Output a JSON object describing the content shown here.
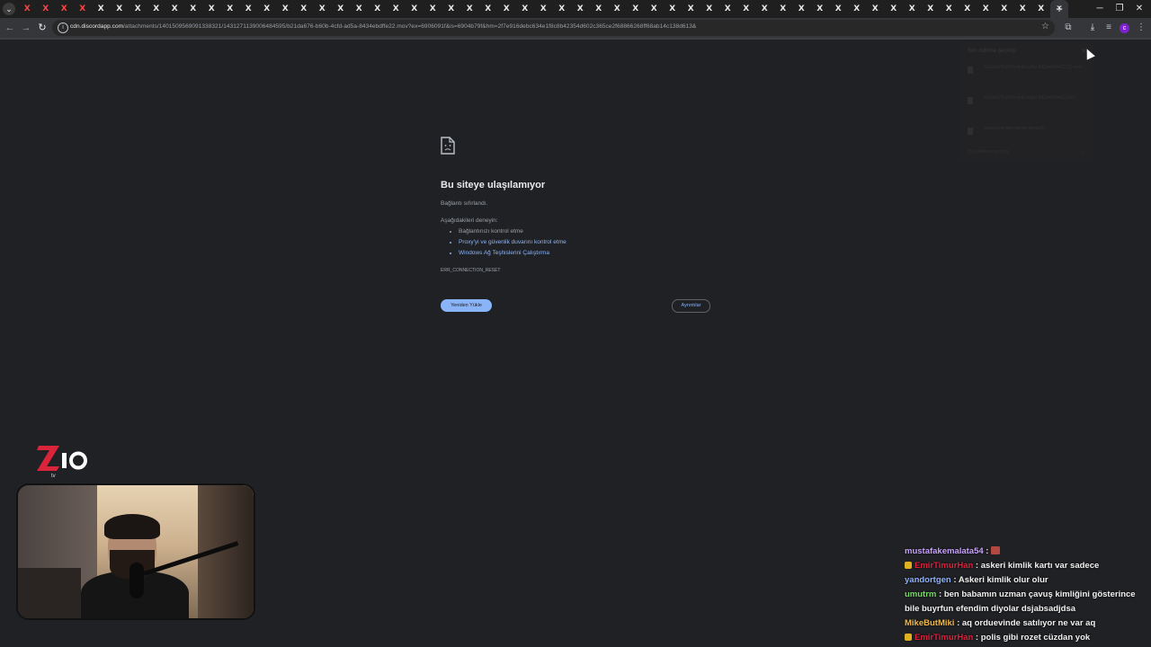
{
  "browser": {
    "tabs": [
      {
        "favicon": "X",
        "style": "red"
      },
      {
        "favicon": "X",
        "style": "red"
      },
      {
        "favicon": "X",
        "style": "red"
      },
      {
        "favicon": "X",
        "style": "red"
      },
      {
        "favicon": "X",
        "style": "white"
      },
      {
        "favicon": "X",
        "style": "white"
      },
      {
        "favicon": "X",
        "style": "white"
      },
      {
        "favicon": "X",
        "style": "white"
      },
      {
        "favicon": "X",
        "style": "white"
      },
      {
        "favicon": "X",
        "style": "white"
      },
      {
        "favicon": "X",
        "style": "white"
      },
      {
        "favicon": "X",
        "style": "white"
      },
      {
        "favicon": "X",
        "style": "white"
      },
      {
        "favicon": "X",
        "style": "white"
      },
      {
        "favicon": "X",
        "style": "white"
      },
      {
        "favicon": "X",
        "style": "white"
      },
      {
        "favicon": "X",
        "style": "white"
      },
      {
        "favicon": "X",
        "style": "white"
      },
      {
        "favicon": "X",
        "style": "white"
      },
      {
        "favicon": "X",
        "style": "white"
      },
      {
        "favicon": "X",
        "style": "white"
      },
      {
        "favicon": "X",
        "style": "white"
      },
      {
        "favicon": "X",
        "style": "white"
      },
      {
        "favicon": "X",
        "style": "white"
      },
      {
        "favicon": "X",
        "style": "white"
      },
      {
        "favicon": "X",
        "style": "white"
      },
      {
        "favicon": "X",
        "style": "white"
      },
      {
        "favicon": "X",
        "style": "white"
      },
      {
        "favicon": "X",
        "style": "white"
      },
      {
        "favicon": "X",
        "style": "white"
      },
      {
        "favicon": "X",
        "style": "white"
      },
      {
        "favicon": "X",
        "style": "white"
      },
      {
        "favicon": "X",
        "style": "white"
      },
      {
        "favicon": "X",
        "style": "white"
      },
      {
        "favicon": "X",
        "style": "white"
      },
      {
        "favicon": "X",
        "style": "white"
      },
      {
        "favicon": "X",
        "style": "white"
      },
      {
        "favicon": "X",
        "style": "white"
      },
      {
        "favicon": "X",
        "style": "white"
      },
      {
        "favicon": "X",
        "style": "white"
      },
      {
        "favicon": "X",
        "style": "white"
      },
      {
        "favicon": "X",
        "style": "white"
      },
      {
        "favicon": "X",
        "style": "white"
      },
      {
        "favicon": "X",
        "style": "white"
      },
      {
        "favicon": "X",
        "style": "white"
      },
      {
        "favicon": "X",
        "style": "white"
      },
      {
        "favicon": "X",
        "style": "white"
      },
      {
        "favicon": "X",
        "style": "white"
      },
      {
        "favicon": "X",
        "style": "white"
      },
      {
        "favicon": "X",
        "style": "white"
      },
      {
        "favicon": "X",
        "style": "white"
      },
      {
        "favicon": "X",
        "style": "white"
      },
      {
        "favicon": "X",
        "style": "white"
      },
      {
        "favicon": "X",
        "style": "white"
      },
      {
        "favicon": "X",
        "style": "white"
      },
      {
        "favicon": "X",
        "style": "white"
      }
    ],
    "active_tab_close": "✕",
    "new_tab": "+",
    "window": {
      "minimize": "─",
      "restore": "❐",
      "close": "✕"
    },
    "url_host": "cdn.discordapp.com",
    "url_path": "/attachments/1401509569091338321/1431271139006484595/b21da676-b60b-4cfd-ad5a-8434ebdffe22.mov?ex=6906091f&is=6904b79f&hm=2f7e916debc634e1f8c8b42354d602c365ce2f68866268ff68ab14c138d613&",
    "icons": [
      "back-icon",
      "forward-icon",
      "reload-icon",
      "site-info-icon",
      "bookmark-star-icon",
      "extensions-icon",
      "download-icon",
      "media-icon",
      "profile-icon",
      "menu-icon"
    ],
    "profile_initial": "c"
  },
  "error_page": {
    "title": "Bu siteye ulaşılamıyor",
    "subtitle": "Bağlantı sıfırlandı.",
    "try_label": "Aşağıdakileri deneyin:",
    "suggestions": [
      {
        "text": "Bağlantınızı kontrol etme",
        "link": false
      },
      {
        "text": "Proxy'yi ve güvenlik duvarını kontrol etme",
        "link": true
      },
      {
        "text": "Windows Ağ Teşhislerini Çalıştırma",
        "link": true
      }
    ],
    "error_code": "ERR_CONNECTION_RESET",
    "reload_button": "Yeniden Yükle",
    "details_button": "Ayrıntılar"
  },
  "downloads_popup": {
    "title": "Son indirme geçmişi",
    "items": [
      {
        "name": "b21da676-b60b-4cfd-ad5a-8434ebdffe22 (1).mov",
        "meta": "..."
      },
      {
        "name": "b21da676-b60b-4cfd-ad5a-8434ebdffe22.mov",
        "meta": "..."
      },
      {
        "name": "Sesoria-kiyafet-devlet-havacilik",
        "meta": "..."
      }
    ],
    "footer": "Tüm indirme geçmişi"
  },
  "overlay": {
    "logo_text": "ZIO",
    "logo_sub": "tv",
    "logo_colors": {
      "z": "#d9243a",
      "io": "#ffffff"
    }
  },
  "chat": [
    {
      "user": "mustafakemalata54",
      "color": "#c9a2ff",
      "badge": false,
      "text": "",
      "emote": true
    },
    {
      "user": "EmirTimurHan",
      "color": "#e0203c",
      "badge": true,
      "text": "askeri kimlik kartı var sadece",
      "emote": false
    },
    {
      "user": "yandortgen",
      "color": "#8fb3ff",
      "badge": false,
      "text": "Askeri kimlik olur olur",
      "emote": false
    },
    {
      "user": "umutrm",
      "color": "#7bd96a",
      "badge": false,
      "text": "ben babamın uzman çavuş kimliğini gösterince bile buyrfun efendim diyolar dsjabsadjdsa",
      "emote": false
    },
    {
      "user": "MikeButMiki",
      "color": "#f0b84c",
      "badge": false,
      "text": "aq orduevinde satılıyor ne var aq",
      "emote": false
    },
    {
      "user": "EmirTimurHan",
      "color": "#e0203c",
      "badge": true,
      "text": "polis gibi rozet cüzdan yok",
      "emote": false
    }
  ]
}
